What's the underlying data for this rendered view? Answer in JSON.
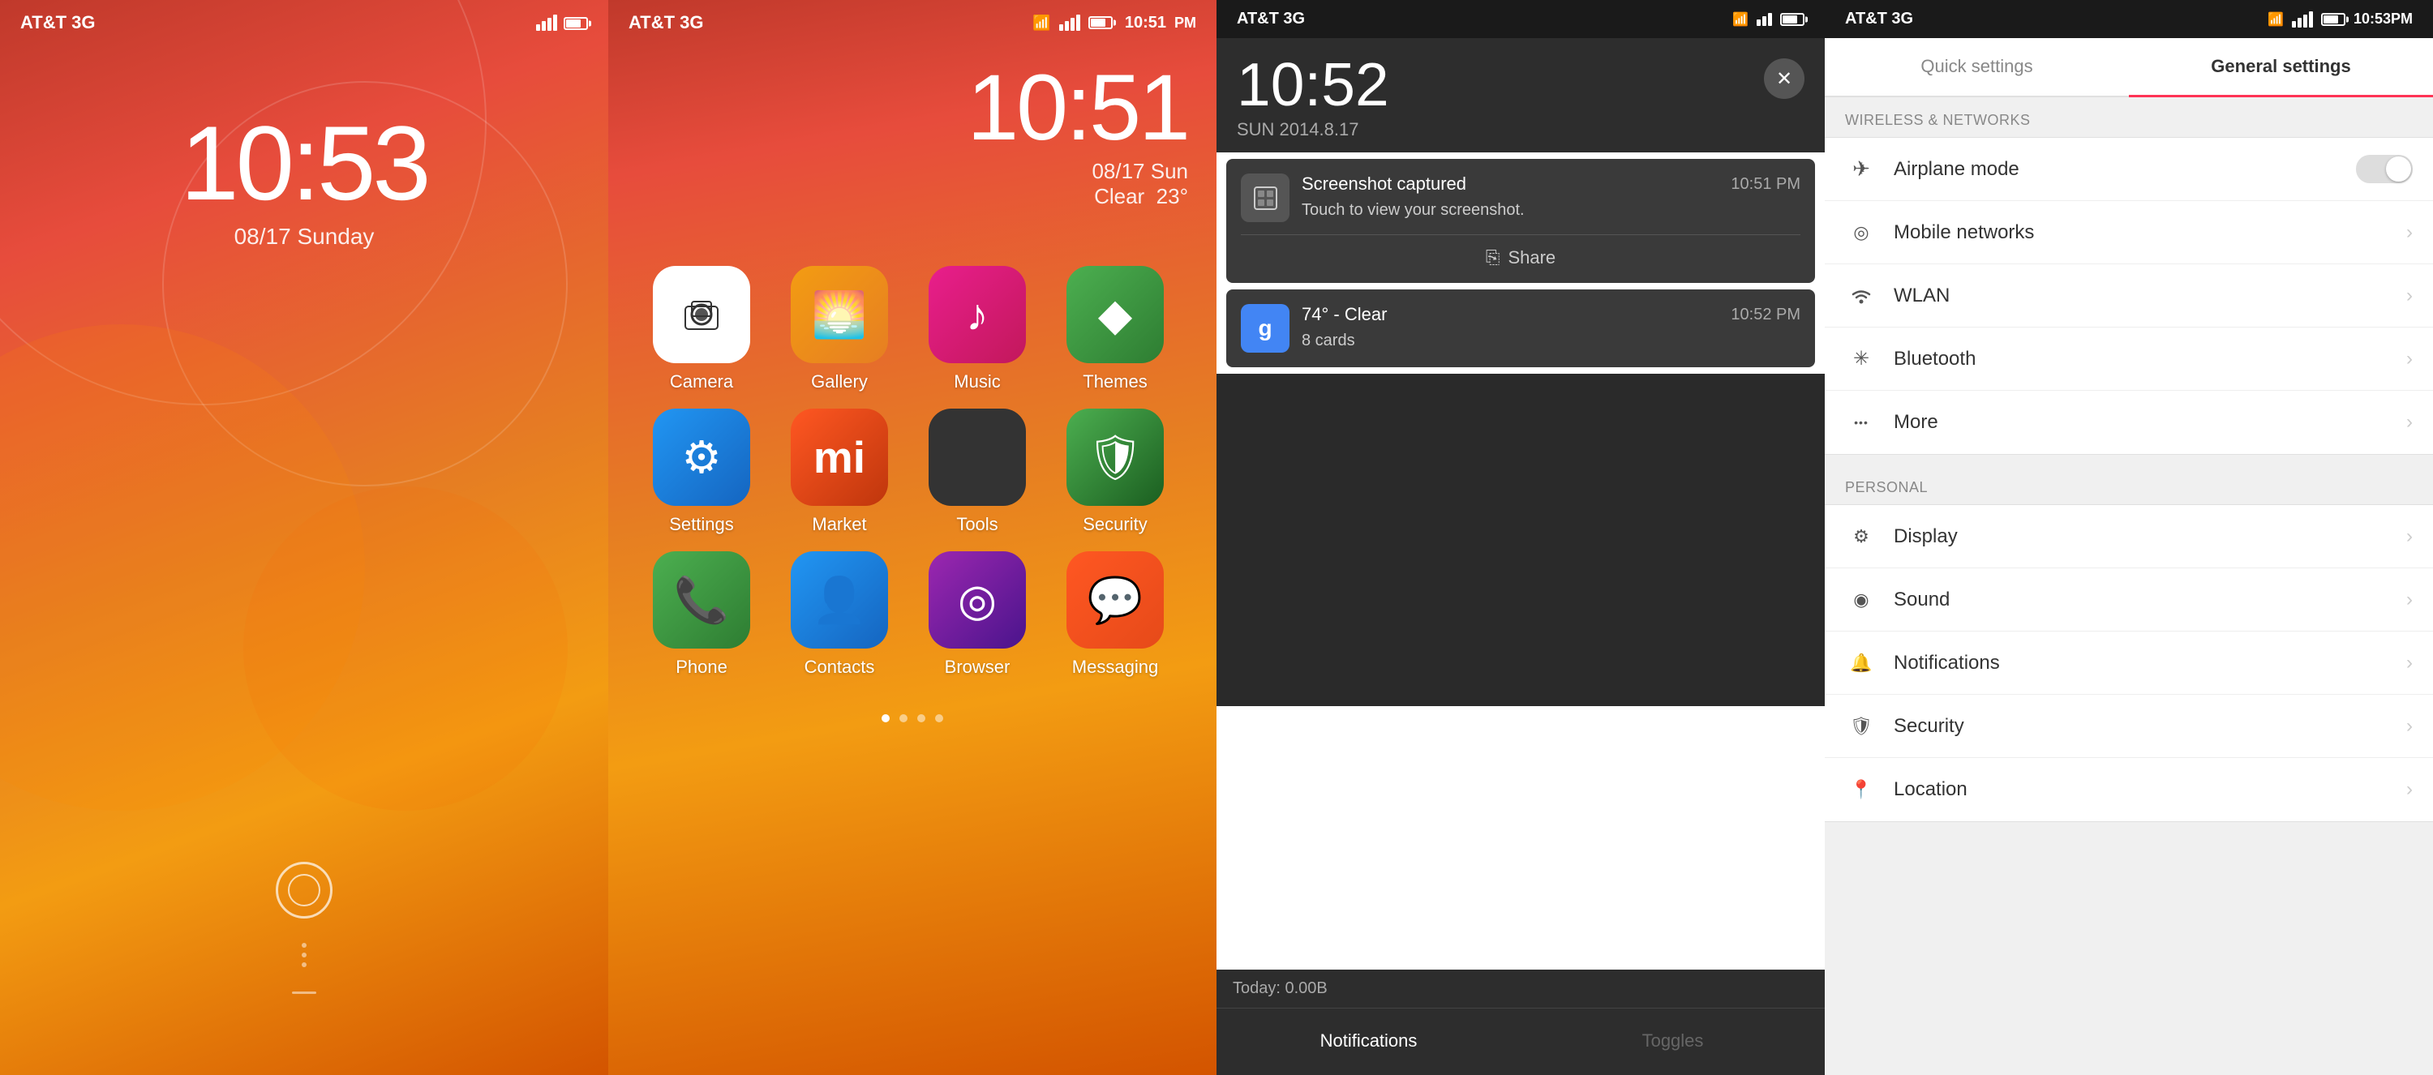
{
  "lockscreen": {
    "carrier": "AT&T 3G",
    "time": "10:53",
    "date": "08/17 Sunday",
    "signal_icon": "signal",
    "wifi_icon": "wifi",
    "battery_icon": "battery"
  },
  "homescreen": {
    "carrier": "AT&T 3G",
    "time": "10:51",
    "date": "08/17 Sun",
    "weather_condition": "Clear",
    "temperature": "23°",
    "apps": [
      {
        "name": "Camera",
        "icon_class": "icon-camera"
      },
      {
        "name": "Gallery",
        "icon_class": "icon-gallery"
      },
      {
        "name": "Music",
        "icon_class": "icon-music"
      },
      {
        "name": "Themes",
        "icon_class": "icon-themes"
      },
      {
        "name": "Settings",
        "icon_class": "icon-settings"
      },
      {
        "name": "Market",
        "icon_class": "icon-market"
      },
      {
        "name": "Tools",
        "icon_class": "icon-tools"
      },
      {
        "name": "Security",
        "icon_class": "icon-security"
      },
      {
        "name": "Phone",
        "icon_class": "icon-phone"
      },
      {
        "name": "Contacts",
        "icon_class": "icon-contacts"
      },
      {
        "name": "Browser",
        "icon_class": "icon-browser"
      },
      {
        "name": "Messaging",
        "icon_class": "icon-messaging"
      }
    ]
  },
  "notifications": {
    "carrier": "AT&T 3G",
    "time_big": "10:52",
    "date_sub": "SUN 2014.8.17",
    "notification1": {
      "title": "Screenshot captured",
      "time": "10:51 PM",
      "body": "Touch to view your screenshot.",
      "share_label": "Share"
    },
    "notification2": {
      "title": "74° - Clear",
      "time": "10:52 PM",
      "sub": "8 cards"
    },
    "today_label": "Today: 0.00B",
    "tab_notifications": "Notifications",
    "tab_toggles": "Toggles"
  },
  "settings": {
    "carrier": "AT&T 3G",
    "time": "10:53PM",
    "tab_quick": "Quick settings",
    "tab_general": "General settings",
    "section_wireless": "WIRELESS & NETWORKS",
    "section_personal": "PERSONAL",
    "items_wireless": [
      {
        "label": "Airplane mode",
        "type": "toggle",
        "icon": "✈"
      },
      {
        "label": "Mobile networks",
        "type": "chevron",
        "icon": "◎"
      },
      {
        "label": "WLAN",
        "type": "chevron",
        "icon": "📶"
      },
      {
        "label": "Bluetooth",
        "type": "chevron",
        "icon": "✳"
      },
      {
        "label": "More",
        "type": "chevron",
        "icon": "•••"
      }
    ],
    "items_personal": [
      {
        "label": "Display",
        "type": "chevron",
        "icon": "⚙"
      },
      {
        "label": "Sound",
        "type": "chevron",
        "icon": "◉"
      },
      {
        "label": "Notifications",
        "type": "chevron",
        "icon": "🔔"
      },
      {
        "label": "Security",
        "type": "chevron",
        "icon": "🛡"
      },
      {
        "label": "Location",
        "type": "chevron",
        "icon": "📍"
      }
    ]
  }
}
